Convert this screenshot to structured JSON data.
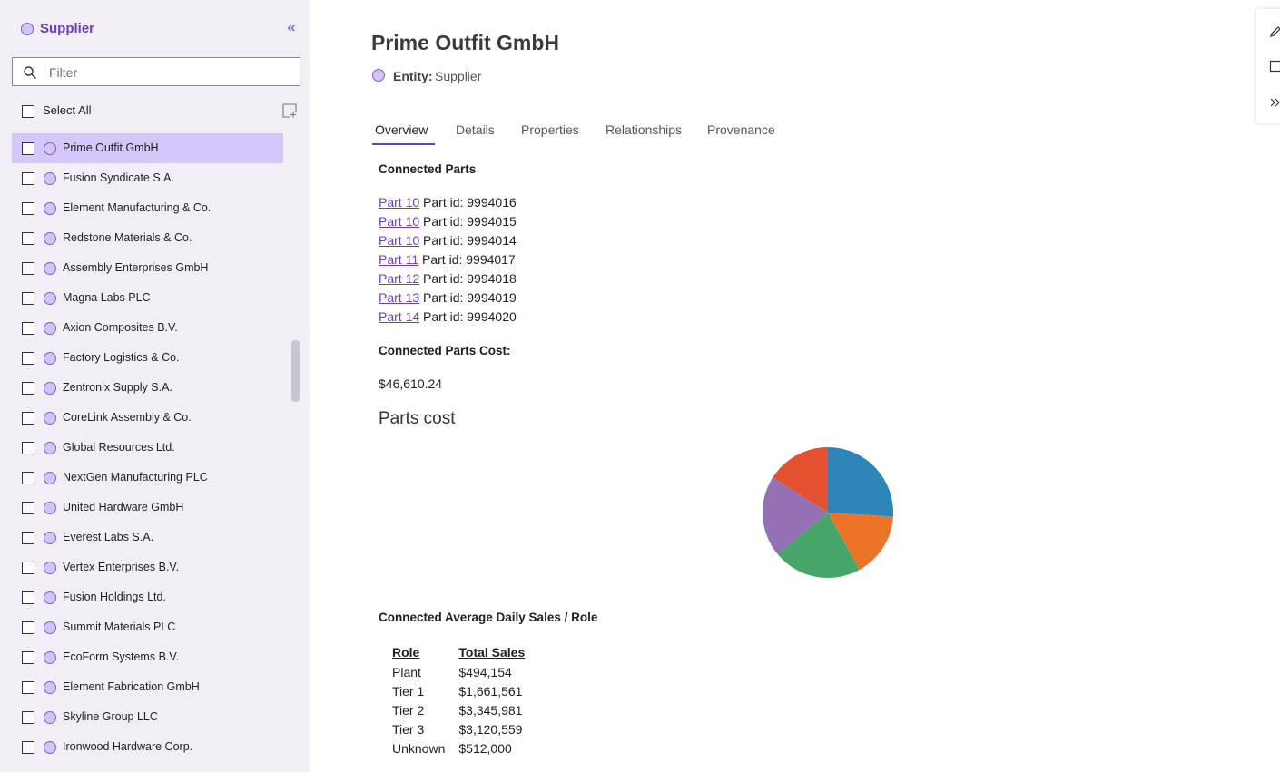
{
  "sidebar": {
    "title": "Supplier",
    "collapse_glyph": "«",
    "filter_placeholder": "Filter",
    "select_all_label": "Select All",
    "items": [
      {
        "label": "Prime Outfit GmbH",
        "selected": true
      },
      {
        "label": "Fusion Syndicate S.A."
      },
      {
        "label": "Element Manufacturing & Co."
      },
      {
        "label": "Redstone Materials & Co."
      },
      {
        "label": "Assembly Enterprises GmbH"
      },
      {
        "label": "Magna Labs PLC"
      },
      {
        "label": "Axion Composites B.V."
      },
      {
        "label": "Factory Logistics & Co."
      },
      {
        "label": "Zentronix Supply S.A."
      },
      {
        "label": "CoreLink Assembly & Co."
      },
      {
        "label": "Global Resources Ltd."
      },
      {
        "label": "NextGen Manufacturing PLC"
      },
      {
        "label": "United Hardware GmbH"
      },
      {
        "label": "Everest Labs S.A."
      },
      {
        "label": "Vertex Enterprises B.V."
      },
      {
        "label": "Fusion Holdings Ltd."
      },
      {
        "label": "Summit Materials PLC"
      },
      {
        "label": "EcoForm Systems B.V."
      },
      {
        "label": "Element Fabrication GmbH"
      },
      {
        "label": "Skyline Group LLC"
      },
      {
        "label": "Ironwood Hardware Corp."
      }
    ]
  },
  "main": {
    "title": "Prime Outfit GmbH",
    "entity_key": "Entity:",
    "entity_value": "Supplier",
    "tabs": [
      {
        "label": "Overview",
        "active": true
      },
      {
        "label": "Details"
      },
      {
        "label": "Properties"
      },
      {
        "label": "Relationships"
      },
      {
        "label": "Provenance"
      }
    ],
    "connected_parts_title": "Connected Parts",
    "parts": [
      {
        "link": "Part 10",
        "text": "Part id: 9994016"
      },
      {
        "link": "Part 10",
        "text": "Part id: 9994015"
      },
      {
        "link": "Part 10",
        "text": "Part id: 9994014"
      },
      {
        "link": "Part 11",
        "text": "Part id: 9994017"
      },
      {
        "link": "Part 12",
        "text": "Part id: 9994018"
      },
      {
        "link": "Part 13",
        "text": "Part id: 9994019"
      },
      {
        "link": "Part 14",
        "text": "Part id: 9994020"
      }
    ],
    "cost_title": "Connected Parts Cost:",
    "cost_value": "$46,610.24",
    "chart_title": "Parts cost",
    "sales_title": "Connected Average Daily Sales / Role",
    "sales_headers": [
      "Role",
      "Total Sales"
    ],
    "sales_rows": [
      [
        "Plant",
        "$494,154"
      ],
      [
        "Tier 1",
        "$1,661,561"
      ],
      [
        "Tier 2",
        "$3,345,981"
      ],
      [
        "Tier 3",
        "$3,120,559"
      ],
      [
        "Unknown",
        "$512,000"
      ]
    ]
  },
  "chart_data": {
    "type": "pie",
    "title": "Parts cost",
    "values": [
      26,
      16,
      22,
      20,
      16
    ],
    "colors": [
      "#2e86b8",
      "#ec7426",
      "#48a56a",
      "#9471b4",
      "#e4512f"
    ]
  },
  "colors": {
    "accent": "#6a3fc1",
    "selected_row": "#d5c7fb",
    "sidebar_bg": "#f1eff5"
  },
  "icons": {
    "search": "search-icon",
    "add": "add-selection-icon",
    "edit": "pencil-icon",
    "expand": "expand-icon",
    "collapse": "collapse-icon"
  }
}
